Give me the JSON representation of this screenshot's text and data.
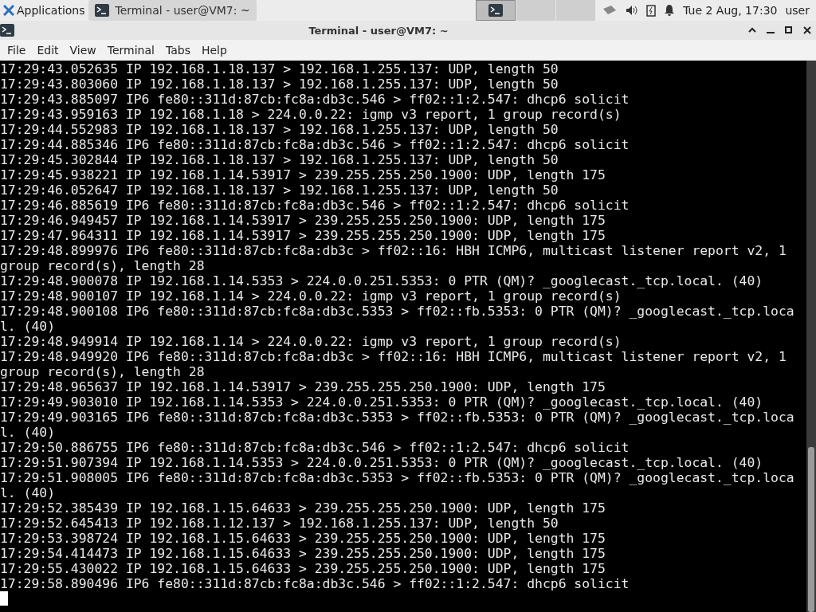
{
  "panel": {
    "apps_menu": "Applications",
    "taskbar": [
      {
        "label": "Terminal - user@VM7: ~",
        "selected": true
      }
    ],
    "clock": "Tue  2 Aug, 17:30",
    "user": "user"
  },
  "window": {
    "title": "Terminal - user@VM7: ~"
  },
  "menu": [
    "File",
    "Edit",
    "View",
    "Terminal",
    "Tabs",
    "Help"
  ],
  "terminal": {
    "lines": [
      "17:29:43.052635 IP 192.168.1.18.137 > 192.168.1.255.137: UDP, length 50",
      "17:29:43.803060 IP 192.168.1.18.137 > 192.168.1.255.137: UDP, length 50",
      "17:29:43.885097 IP6 fe80::311d:87cb:fc8a:db3c.546 > ff02::1:2.547: dhcp6 solicit",
      "17:29:43.959163 IP 192.168.1.18 > 224.0.0.22: igmp v3 report, 1 group record(s)",
      "17:29:44.552983 IP 192.168.1.18.137 > 192.168.1.255.137: UDP, length 50",
      "17:29:44.885346 IP6 fe80::311d:87cb:fc8a:db3c.546 > ff02::1:2.547: dhcp6 solicit",
      "17:29:45.302844 IP 192.168.1.18.137 > 192.168.1.255.137: UDP, length 50",
      "17:29:45.938221 IP 192.168.1.14.53917 > 239.255.255.250.1900: UDP, length 175",
      "17:29:46.052647 IP 192.168.1.18.137 > 192.168.1.255.137: UDP, length 50",
      "17:29:46.885619 IP6 fe80::311d:87cb:fc8a:db3c.546 > ff02::1:2.547: dhcp6 solicit",
      "17:29:46.949457 IP 192.168.1.14.53917 > 239.255.255.250.1900: UDP, length 175",
      "17:29:47.964311 IP 192.168.1.14.53917 > 239.255.255.250.1900: UDP, length 175",
      "17:29:48.899976 IP6 fe80::311d:87cb:fc8a:db3c > ff02::16: HBH ICMP6, multicast listener report v2, 1",
      "group record(s), length 28",
      "17:29:48.900078 IP 192.168.1.14.5353 > 224.0.0.251.5353: 0 PTR (QM)? _googlecast._tcp.local. (40)",
      "17:29:48.900107 IP 192.168.1.14 > 224.0.0.22: igmp v3 report, 1 group record(s)",
      "17:29:48.900108 IP6 fe80::311d:87cb:fc8a:db3c.5353 > ff02::fb.5353: 0 PTR (QM)? _googlecast._tcp.loca",
      "l. (40)",
      "17:29:48.949914 IP 192.168.1.14 > 224.0.0.22: igmp v3 report, 1 group record(s)",
      "17:29:48.949920 IP6 fe80::311d:87cb:fc8a:db3c > ff02::16: HBH ICMP6, multicast listener report v2, 1",
      "group record(s), length 28",
      "17:29:48.965637 IP 192.168.1.14.53917 > 239.255.255.250.1900: UDP, length 175",
      "17:29:49.903010 IP 192.168.1.14.5353 > 224.0.0.251.5353: 0 PTR (QM)? _googlecast._tcp.local. (40)",
      "17:29:49.903165 IP6 fe80::311d:87cb:fc8a:db3c.5353 > ff02::fb.5353: 0 PTR (QM)? _googlecast._tcp.loca",
      "l. (40)",
      "17:29:50.886755 IP6 fe80::311d:87cb:fc8a:db3c.546 > ff02::1:2.547: dhcp6 solicit",
      "17:29:51.907394 IP 192.168.1.14.5353 > 224.0.0.251.5353: 0 PTR (QM)? _googlecast._tcp.local. (40)",
      "17:29:51.908005 IP6 fe80::311d:87cb:fc8a:db3c.5353 > ff02::fb.5353: 0 PTR (QM)? _googlecast._tcp.loca",
      "l. (40)",
      "17:29:52.385439 IP 192.168.1.15.64633 > 239.255.255.250.1900: UDP, length 175",
      "17:29:52.645413 IP 192.168.1.12.137 > 192.168.1.255.137: UDP, length 50",
      "17:29:53.398724 IP 192.168.1.15.64633 > 239.255.255.250.1900: UDP, length 175",
      "17:29:54.414473 IP 192.168.1.15.64633 > 239.255.255.250.1900: UDP, length 175",
      "17:29:55.430022 IP 192.168.1.15.64633 > 239.255.255.250.1900: UDP, length 175",
      "17:29:58.890496 IP6 fe80::311d:87cb:fc8a:db3c.546 > ff02::1:2.547: dhcp6 solicit"
    ]
  }
}
